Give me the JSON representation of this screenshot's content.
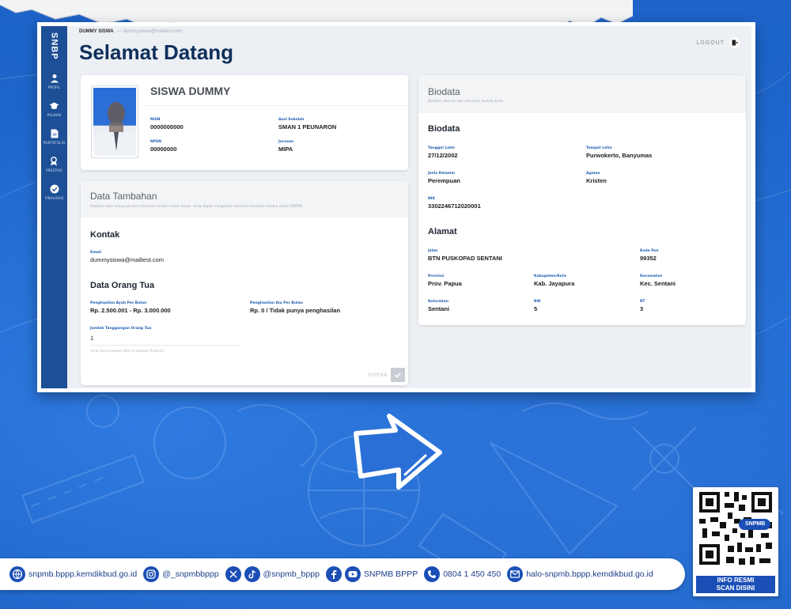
{
  "app": {
    "brand": "SNBP",
    "topline_name": "DUMMY SISWA",
    "topline_email": "— dummysiswa@mailtest.com",
    "welcome": "Selamat Datang",
    "logout_label": "LOGOUT"
  },
  "sidebar": {
    "items": [
      {
        "label": "PROFIL",
        "icon": "user-icon"
      },
      {
        "label": "PILIHAN",
        "icon": "graduation-cap-icon"
      },
      {
        "label": "PORTOFOLIO",
        "icon": "document-icon"
      },
      {
        "label": "PRESTASI",
        "icon": "award-icon"
      },
      {
        "label": "FINALISASI",
        "icon": "check-circle-icon"
      }
    ]
  },
  "profile": {
    "name": "SISWA DUMMY",
    "nisn_label": "NISN",
    "nisn": "0000000000",
    "npsn_label": "NPSN",
    "npsn": "00000000",
    "sekolah_label": "Asal Sekolah",
    "sekolah": "SMAN 1 PEUNARON",
    "jurusan_label": "Jurusan",
    "jurusan": "MIPA"
  },
  "tambahan": {
    "title": "Data Tambahan",
    "subtitle": "Pastikan data orang tua dan informasi kontak sudah sesuai. Anda dapat mengubah informasi tersebut melalui portal SNPMB.",
    "kontak_title": "Kontak",
    "email_label": "Email",
    "email": "dummysiswa@mailtest.com",
    "ortu_title": "Data Orang Tua",
    "ayah_label": "Penghasilan Ayah Per Bulan",
    "ayah": "Rp. 2.500.001 - Rp. 3.000.000",
    "ibu_label": "Penghasilan Ibu Per Bulan",
    "ibu": "Rp. 0 / Tidak punya penghasilan",
    "tanggungan_label": "Jumlah Tanggungan Orang Tua",
    "tanggungan": "1",
    "hint": "Anda harus mengisi data ini sebelum finalisasi",
    "save_label": "SIMPAN"
  },
  "biodata": {
    "title": "Biodata",
    "subtitle": "Biodata, alamat, dan informasi kontak Anda",
    "section_title": "Biodata",
    "tgl_label": "Tanggal Lahir",
    "tgl": "27/12/2002",
    "tempat_label": "Tempat Lahir",
    "tempat": "Purwokerto, Banyumas",
    "jk_label": "Jenis Kelamin",
    "jk": "Perempuan",
    "agama_label": "Agama",
    "agama": "Kristen",
    "nik_label": "NIK",
    "nik": "3302246712020001",
    "alamat_title": "Alamat",
    "jalan_label": "Jalan",
    "jalan": "BTN PUSKOPAD SENTANI",
    "kodepos_label": "Kode Pos",
    "kodepos": "99352",
    "provinsi_label": "Provinsi",
    "provinsi": "Prov. Papua",
    "kabupaten_label": "Kabupaten/Kota",
    "kabupaten": "Kab. Jayapura",
    "kecamatan_label": "Kecamatan",
    "kecamatan": "Kec. Sentani",
    "kelurahan_label": "Kelurahan",
    "kelurahan": "Sentani",
    "rw_label": "RW",
    "rw": "5",
    "rt_label": "RT",
    "rt": "3"
  },
  "footer": {
    "website": "snpmb.bppp.kemdikbud.go.id",
    "instagram": "@_snpmbbppp",
    "x_tiktok": "@snpmb_bppp",
    "facebook_youtube": "SNPMB BPPP",
    "phone": "0804 1 450 450",
    "email": "halo-snpmb.bppp.kemdikbud.go.id"
  },
  "qr": {
    "badge": "SNPMB",
    "line1": "INFO RESMI",
    "line2": "SCAN DISINI"
  },
  "colors": {
    "background": "#1a5fc4",
    "sidebar": "#1d4f96",
    "heading": "#0e2f5c",
    "accent": "#1f5fb3",
    "footer_icon": "#1b4fb6"
  }
}
